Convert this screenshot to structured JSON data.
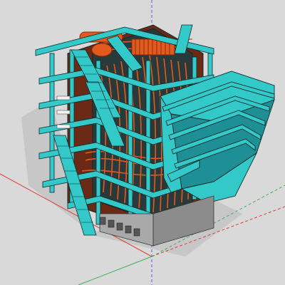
{
  "viewport": {
    "background": "#d9d9d9",
    "axis_colors": {
      "red": "#e23a3a",
      "green": "#3cb35a",
      "blue": "#5a5ae0"
    }
  },
  "model": {
    "subject": "boiler-structure",
    "colors": {
      "steel": "#33c9c9",
      "steel_dark": "#1e8f94",
      "edge": "#0f2a2c",
      "pipes": "#e35a1f",
      "pipes_dark": "#8a2a10",
      "shadow": "#b9b9b9",
      "base": "#8c8c8c"
    }
  }
}
